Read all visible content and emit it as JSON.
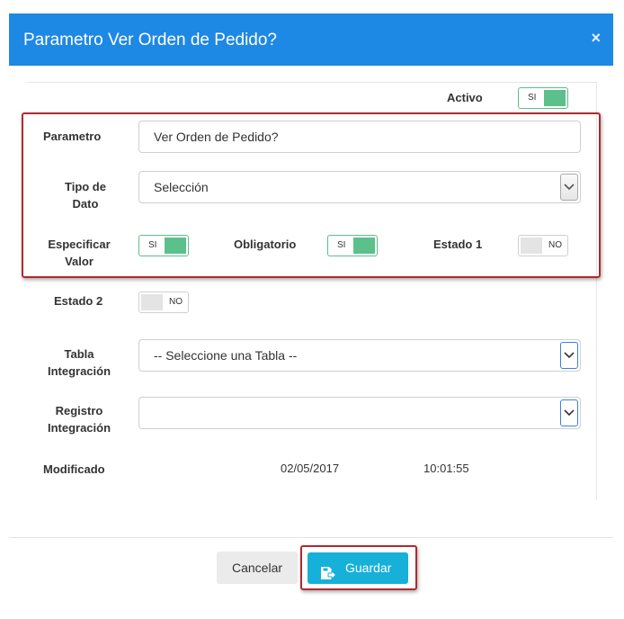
{
  "dialog": {
    "title": "Parametro Ver Orden de Pedido?",
    "close_glyph": "×"
  },
  "form": {
    "activo": {
      "label": "Activo",
      "toggle": "SI",
      "on": true
    },
    "parametro": {
      "label": "Parametro",
      "value": "Ver Orden de Pedido?"
    },
    "tipo_dato": {
      "label_line1": "Tipo de",
      "label_line2": "Dato",
      "value": "Selección"
    },
    "especificar_valor": {
      "label_line1": "Especificar",
      "label_line2": "Valor",
      "toggle": "SI",
      "on": true
    },
    "obligatorio": {
      "label": "Obligatorio",
      "toggle": "SI",
      "on": true
    },
    "estado1": {
      "label": "Estado 1",
      "toggle": "NO",
      "on": false
    },
    "estado2": {
      "label": "Estado 2",
      "toggle": "NO",
      "on": false
    },
    "tabla_integracion": {
      "label_line1": "Tabla",
      "label_line2": "Integración",
      "value": "-- Seleccione una Tabla --"
    },
    "registro_integracion": {
      "label_line1": "Registro",
      "label_line2": "Integración",
      "value": ""
    },
    "modificado": {
      "label": "Modificado",
      "date": "02/05/2017",
      "time": "10:01:55"
    }
  },
  "footer": {
    "cancel_label": "Cancelar",
    "save_label": "Guardar",
    "save_icon": "save-icon"
  },
  "colors": {
    "header": "#1e88e5",
    "toggle_on": "#5cc08b",
    "save_button": "#16b0d9",
    "highlight": "#b02a30"
  }
}
